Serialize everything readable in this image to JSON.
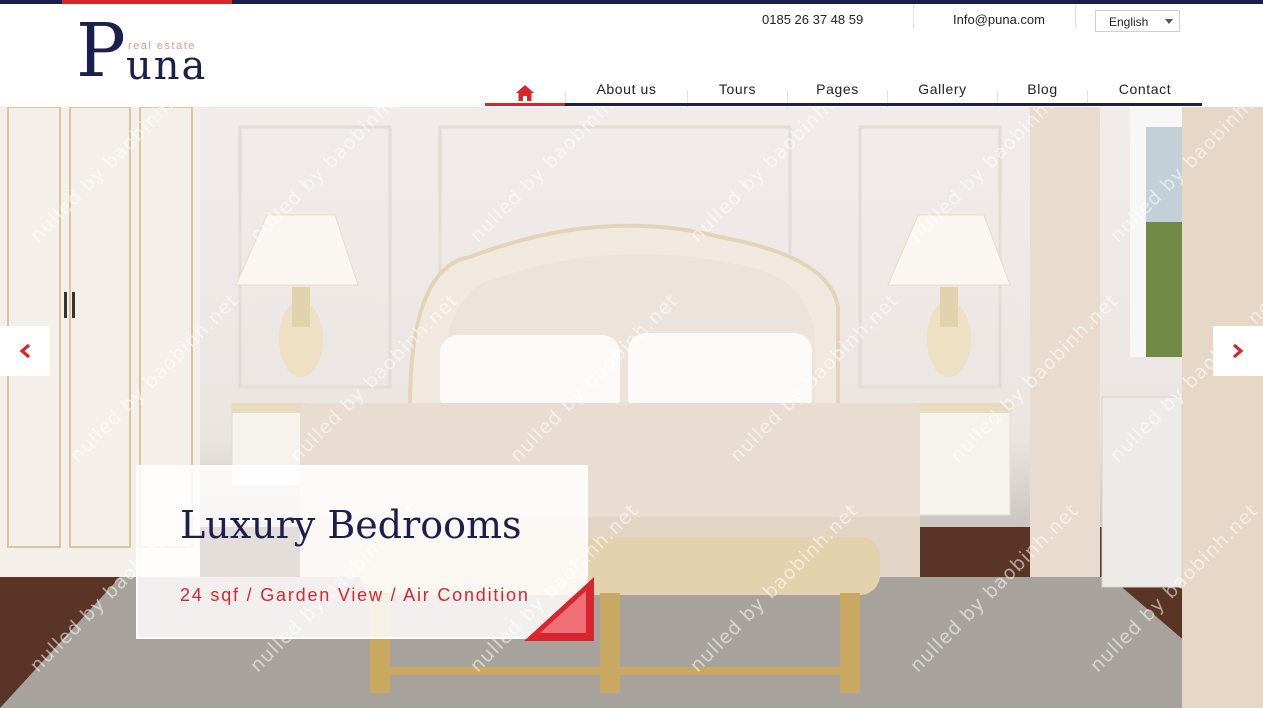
{
  "brand": {
    "initial": "P",
    "rest": "una",
    "tagline": "real estate"
  },
  "contact": {
    "phone": "0185 26 37 48 59",
    "email": "Info@puna.com"
  },
  "language": {
    "selected": "English"
  },
  "nav": {
    "home_icon": "home-icon",
    "items": [
      "About us",
      "Tours",
      "Pages",
      "Gallery",
      "Blog",
      "Contact"
    ]
  },
  "slider": {
    "title": "Luxury Bedrooms",
    "subtitle": "24 sqf / Garden View / Air Condition",
    "prev_icon": "chevron-left-icon",
    "next_icon": "chevron-right-icon"
  },
  "watermark": "nulled by baobinh.net",
  "colors": {
    "navy": "#1a1f4e",
    "red": "#d8262f"
  }
}
